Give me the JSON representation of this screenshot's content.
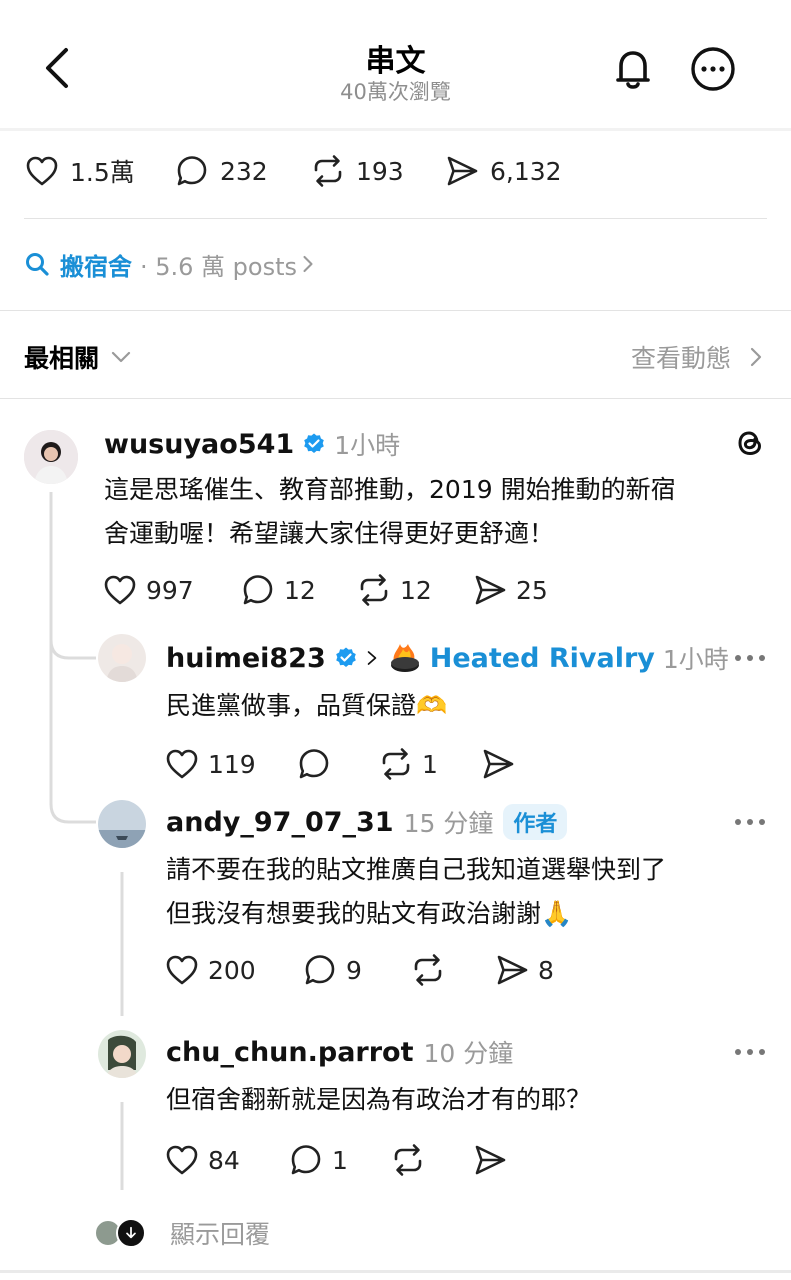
{
  "header": {
    "title": "串文",
    "subtitle": "40萬次瀏覽"
  },
  "stats": {
    "likes": "1.5萬",
    "replies": "232",
    "reposts": "193",
    "shares": "6,132"
  },
  "topic": {
    "name": "搬宿舍",
    "count": "· 5.6 萬 posts"
  },
  "sort": {
    "label": "最相關",
    "activity_label": "查看動態"
  },
  "posts": [
    {
      "username": "wusuyao541",
      "time": "1小時",
      "text_line1": "這是思瑤催生、教育部推動，2019 開始推動的新宿",
      "text_line2": "舍運動喔！希望讓大家住得更好更舒適！",
      "likes": "997",
      "replies": "12",
      "reposts": "12",
      "shares": "25"
    },
    {
      "username": "huimei823",
      "tag": "Heated Rivalry",
      "time": "1小時",
      "text": "民進黨做事，品質保證🫶",
      "likes": "119",
      "replies": "",
      "reposts": "1",
      "shares": ""
    },
    {
      "username": "andy_97_07_31",
      "time": "15 分鐘",
      "badge": "作者",
      "text_line1": "請不要在我的貼文推廣自己我知道選舉快到了",
      "text_line2": "但我沒有想要我的貼文有政治謝謝🙏",
      "likes": "200",
      "replies": "9",
      "reposts": "",
      "shares": "8"
    },
    {
      "username": "chu_chun.parrot",
      "time": "10 分鐘",
      "text": "但宿舍翻新就是因為有政治才有的耶？",
      "likes": "84",
      "replies": "1",
      "reposts": "",
      "shares": ""
    }
  ],
  "show_replies": "顯示回覆",
  "colors": {
    "accent": "#1a8fd6",
    "muted": "#9a9a9a",
    "verified": "#1d9bf0"
  }
}
